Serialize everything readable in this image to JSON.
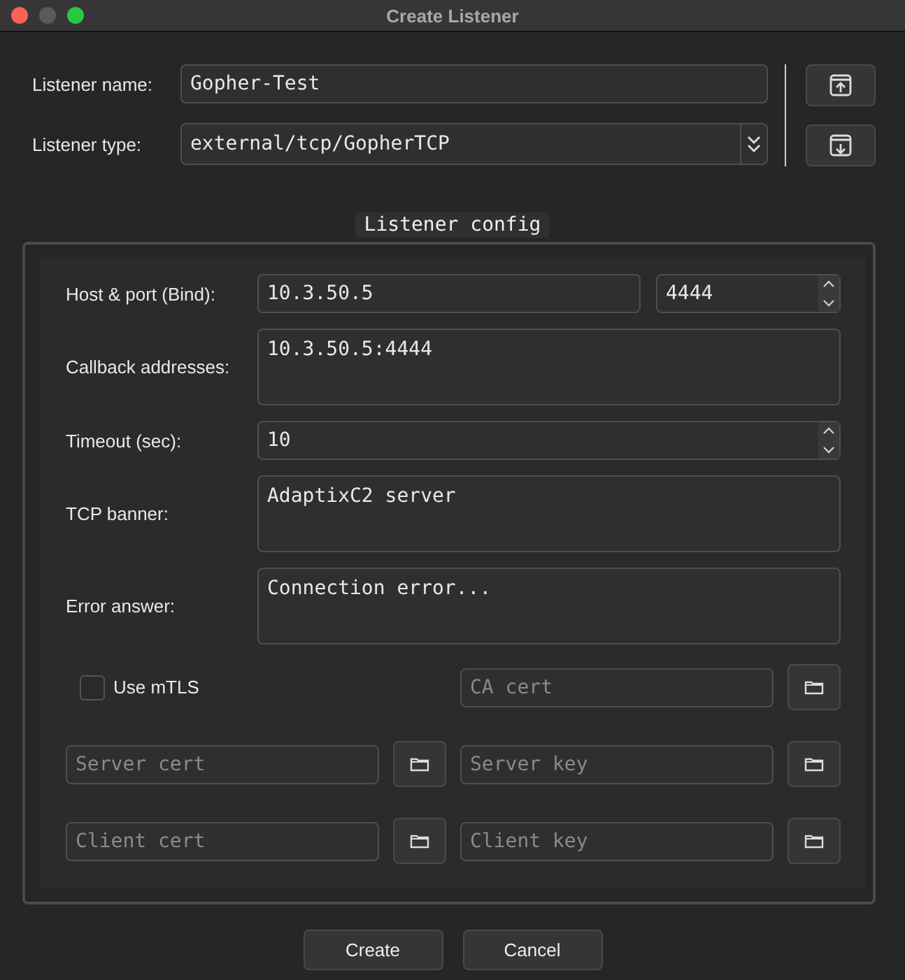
{
  "window": {
    "title": "Create Listener"
  },
  "listener_name": {
    "label": "Listener name:",
    "value": "Gopher-Test"
  },
  "listener_type": {
    "label": "Listener type:",
    "value": "external/tcp/GopherTCP"
  },
  "config": {
    "title": "Listener config",
    "fields": [
      {
        "kind": "host_port",
        "label": "Host & port (Bind):",
        "value": "10.3.50.5",
        "port": "4444"
      },
      {
        "kind": "textarea",
        "label": "Callback addresses:",
        "value": "10.3.50.5:4444"
      },
      {
        "kind": "spin",
        "label": "Timeout (sec):",
        "value": "10"
      },
      {
        "kind": "textarea",
        "label": "TCP banner:",
        "value": "AdaptixC2 server"
      },
      {
        "kind": "textarea",
        "label": "Error answer:",
        "value": "Connection error..."
      }
    ],
    "use_mtls": {
      "label": "Use mTLS",
      "checked": false
    },
    "cert_fields": [
      {
        "placeholder": "CA cert"
      },
      {
        "placeholder": "Server cert"
      },
      {
        "placeholder": "Server key"
      },
      {
        "placeholder": "Client cert"
      },
      {
        "placeholder": "Client key"
      }
    ]
  },
  "buttons": [
    "Create",
    "Cancel"
  ]
}
